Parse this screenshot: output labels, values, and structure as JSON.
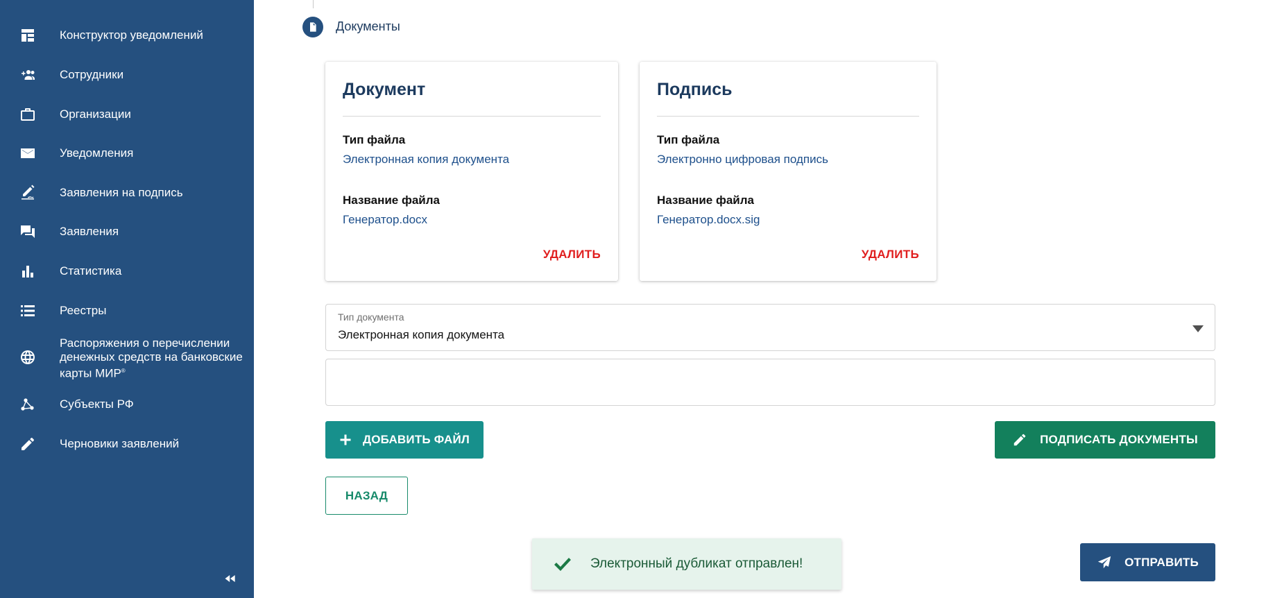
{
  "sidebar": {
    "items": [
      {
        "label": "Конструктор уведомлений",
        "icon": "dashboard-icon"
      },
      {
        "label": "Сотрудники",
        "icon": "add-people-icon"
      },
      {
        "label": "Организации",
        "icon": "briefcase-icon"
      },
      {
        "label": "Уведомления",
        "icon": "mail-icon"
      },
      {
        "label": "Заявления на подпись",
        "icon": "sign-pen-icon"
      },
      {
        "label": "Заявления",
        "icon": "forum-icon"
      },
      {
        "label": "Статистика",
        "icon": "bar-chart-icon"
      },
      {
        "label": "Реестры",
        "icon": "list-icon"
      },
      {
        "label": "Распоряжения о перечислении денежных средств на банковские карты МИР",
        "icon": "globe-icon"
      },
      {
        "label": "Субъекты РФ",
        "icon": "share-nodes-icon"
      },
      {
        "label": "Черновики заявлений",
        "icon": "pencil-icon"
      }
    ],
    "mir_trademark": "®"
  },
  "step": {
    "title": "Документы"
  },
  "cards": {
    "document": {
      "title": "Документ",
      "file_type_label": "Тип файла",
      "file_type_value": "Электронная копия документа",
      "file_name_label": "Название файла",
      "file_name_value": "Генератор.docx",
      "delete_label": "УДАЛИТЬ"
    },
    "signature": {
      "title": "Подпись",
      "file_type_label": "Тип файла",
      "file_type_value": "Электронно цифровая подпись",
      "file_name_label": "Название файла",
      "file_name_value": "Генератор.docx.sig",
      "delete_label": "УДАЛИТЬ"
    }
  },
  "form": {
    "doc_type_label": "Тип документа",
    "doc_type_value": "Электронная копия документа",
    "extra_field_value": ""
  },
  "actions": {
    "add_file": "ДОБАВИТЬ ФАЙЛ",
    "sign_documents": "ПОДПИСАТЬ ДОКУМЕНТЫ",
    "back": "НАЗАД",
    "send": "ОТПРАВИТЬ"
  },
  "toast": {
    "message": "Электронный дубликат отправлен!",
    "icon": "checkmark-icon"
  },
  "colors": {
    "sidebar_bg": "#25507f",
    "primary": "#25507f",
    "teal": "#17908c",
    "green": "#13805c",
    "danger": "#e01e1e",
    "toast_bg": "#e6f3ec"
  }
}
